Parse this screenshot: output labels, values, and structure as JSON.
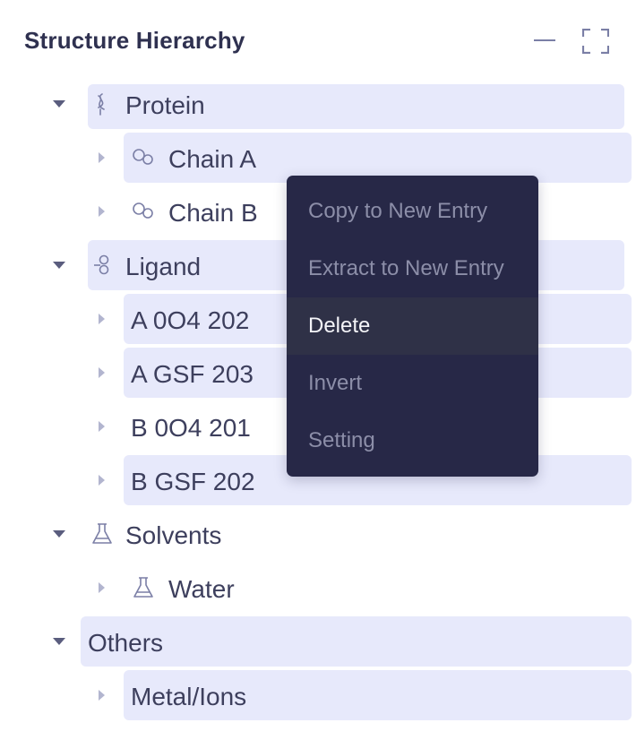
{
  "panel": {
    "title": "Structure Hierarchy",
    "minimize_icon": "minimize-icon",
    "fullscreen_icon": "fullscreen-icon"
  },
  "tree": {
    "protein": {
      "label": "Protein",
      "icon": "protein-helix-icon",
      "expanded": true,
      "children": [
        {
          "label": "Chain A",
          "icon": "chain-icon"
        },
        {
          "label": "Chain B",
          "icon": "chain-icon"
        }
      ]
    },
    "ligand": {
      "label": "Ligand",
      "icon": "ligand-molecule-icon",
      "expanded": true,
      "children": [
        {
          "label": "A 0O4 202"
        },
        {
          "label": "A GSF 203"
        },
        {
          "label": "B 0O4 201"
        },
        {
          "label": "B GSF 202"
        }
      ]
    },
    "solvents": {
      "label": "Solvents",
      "icon": "flask-icon",
      "expanded": true,
      "children": [
        {
          "label": "Water",
          "icon": "flask-icon"
        }
      ]
    },
    "others": {
      "label": "Others",
      "expanded": true,
      "children": [
        {
          "label": "Metal/Ions"
        }
      ]
    }
  },
  "context_menu": {
    "items": [
      {
        "label": "Copy to New Entry"
      },
      {
        "label": "Extract to New Entry"
      },
      {
        "label": "Delete",
        "hovered": true
      },
      {
        "label": "Invert"
      },
      {
        "label": "Setting"
      }
    ]
  },
  "colors": {
    "highlight": "#e7e9fb",
    "menu_bg": "#272847",
    "menu_hover": "#2f3147",
    "text": "#3d3f5d"
  }
}
